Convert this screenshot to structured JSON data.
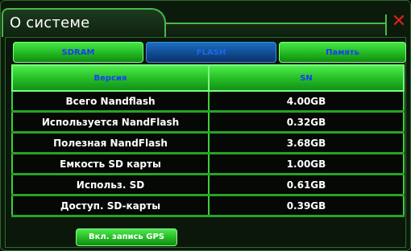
{
  "window": {
    "title": "О системе",
    "close_glyph": "✕"
  },
  "tabs": [
    {
      "label": "SDRAM",
      "active": false
    },
    {
      "label": "FLASH",
      "active": true
    },
    {
      "label": "Память",
      "active": false
    }
  ],
  "table": {
    "headers": [
      "Версия",
      "SN"
    ],
    "rows": [
      {
        "name": "Всего Nandflash",
        "value": "4.00GB"
      },
      {
        "name": "Используется NandFlash",
        "value": "0.32GB"
      },
      {
        "name": "Полезная NandFlash",
        "value": "3.68GB"
      },
      {
        "name": "Емкость SD карты",
        "value": "1.00GB"
      },
      {
        "name": "Использ. SD",
        "value": "0.61GB"
      },
      {
        "name": "Доступ. SD-карты",
        "value": "0.39GB"
      }
    ]
  },
  "footer": {
    "gps_button_label": "Вкл. запись GPS"
  },
  "colors": {
    "accent_green": "#46e646",
    "active_tab_blue": "#1c6ec2",
    "close_red": "#e02020"
  }
}
